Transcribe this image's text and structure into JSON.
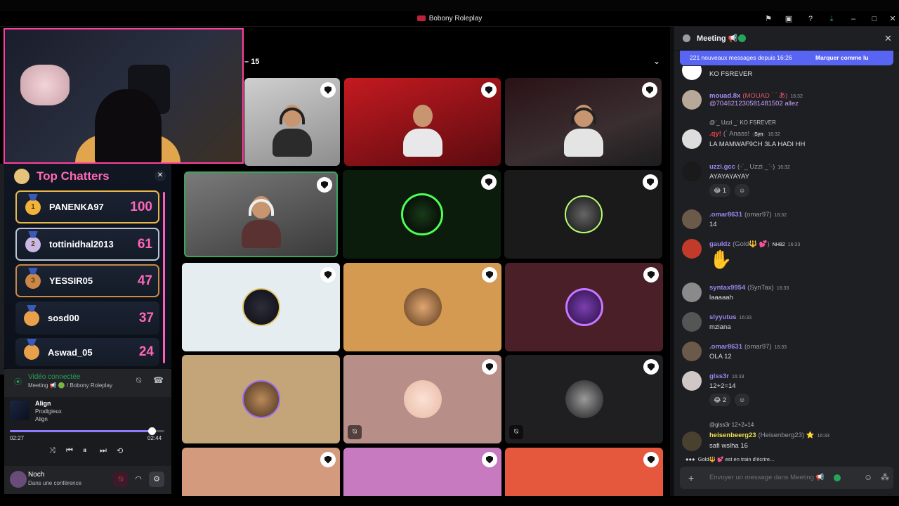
{
  "window": {
    "title": "Bobony Roleplay"
  },
  "stage": {
    "count": "15"
  },
  "top_chatters": {
    "title": "Top Chatters",
    "rows": [
      {
        "rank": "1",
        "name": "PANENKA97",
        "score": "100"
      },
      {
        "rank": "2",
        "name": "tottinidhal2013",
        "score": "61"
      },
      {
        "rank": "3",
        "name": "YESSIR05",
        "score": "47"
      },
      {
        "rank": "",
        "name": "sosd00",
        "score": "37"
      },
      {
        "rank": "",
        "name": "Aswad_05",
        "score": "24"
      }
    ]
  },
  "voice": {
    "status": "Vidéo connectée",
    "channel": "Meeting 📢 🟢 / Bobony Roleplay"
  },
  "music": {
    "title": "Align",
    "artist": "Prodigieux",
    "album": "Align",
    "current": "02:27",
    "total": "02:44",
    "progress": 0.92
  },
  "user": {
    "name": "Noch",
    "status": "Dans une conférence"
  },
  "chat": {
    "channel": "Meeting 📢",
    "banner_text": "221 nouveaux messages depuis 16:26",
    "banner_action": "Marquer comme lu",
    "composer_placeholder": "Envoyer un message dans Meeting 📢",
    "typing": "Gold🔱 💕 est en train d'écrire...",
    "messages": [
      {
        "text": "KO FSREVER"
      },
      {
        "name": "mouad.8x",
        "alias": "(MOUAD ᐝ ᐝ あ)",
        "time": "16:32",
        "text": "@704621230581481502 allez",
        "name_color": "#a78bfa"
      },
      {
        "reply": "@ᐝ_ Uzzi _ᐝ KO FSREVER",
        "name": ".qy!",
        "alias": "(ᐝ Anass!",
        "badge": "Syn",
        "time": "16:32",
        "text": "LA MAMWAF9CH 3LA HADI HH",
        "name_color": "#f23f43"
      },
      {
        "name": "uzzi.gcc",
        "alias": "(-ˋ_ Uzzi _ˊ-)",
        "time": "16:32",
        "text": "AYAYAYAYAY",
        "name_color": "#9b84ec",
        "reaction": "😂 1"
      },
      {
        "name": ".omar8631",
        "alias": "(omar97)",
        "time": "16:32",
        "text": "14",
        "name_color": "#9b84ec"
      },
      {
        "name": "gauldz",
        "alias": "(Gold🔱 💕)",
        "badge": "NH82",
        "time": "16:33",
        "text": "✋",
        "name_color": "#9b84ec"
      },
      {
        "name": "syntax9954",
        "alias": "(SynTax)",
        "time": "16:33",
        "text": "laaaaah",
        "name_color": "#9b84ec"
      },
      {
        "name": "slyyutus",
        "time": "16:33",
        "text": "mziana",
        "name_color": "#9b84ec"
      },
      {
        "name": ".omar8631",
        "alias": "(omar97)",
        "time": "16:33",
        "text": "OLA 12",
        "name_color": "#9b84ec"
      },
      {
        "name": "glss3r",
        "time": "16:33",
        "text": "12+2=14",
        "name_color": "#9b84ec",
        "reaction": "😂 2"
      },
      {
        "reply": "@glss3r 12+2=14",
        "name": "heisenbeerg23",
        "alias": "(Heisenberg23) ⭐",
        "time": "16:33",
        "text": "safi wslha 16",
        "name_color": "#f0e04b"
      }
    ]
  },
  "colors": {
    "accent_pink": "#ff66b8",
    "discord_blurple": "#5865f2",
    "online_green": "#23a55a"
  }
}
